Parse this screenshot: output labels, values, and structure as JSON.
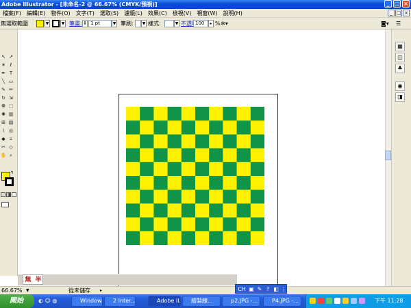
{
  "window": {
    "title": "Adobe Illustrator - [未命名-2 @ 66.67% (CMYK/預視)]",
    "buttons": [
      "_",
      "□",
      "×"
    ]
  },
  "menubar": {
    "items": [
      "檔案(F)",
      "編輯(E)",
      "物件(O)",
      "文字(T)",
      "選取(S)",
      "濾鏡(L)",
      "效果(C)",
      "檢視(V)",
      "視窗(W)",
      "說明(H)"
    ],
    "doc_buttons": [
      "_",
      "□",
      "×"
    ]
  },
  "controlbar": {
    "selection_label": "無選取範圍",
    "stroke_label": "筆畫:",
    "stroke_weight": "1 pt",
    "brush_label": "筆刷:",
    "style_label": "樣式:",
    "opacity_label": "不透明度:",
    "opacity_value": "100",
    "opacity_unit": "%"
  },
  "colors": {
    "yellow": "#FFF200",
    "green": "#109447",
    "fill_swatch": "#FFF200",
    "stroke_swatch": "#000000"
  },
  "checkerboard": {
    "rows": 10,
    "cols": 10
  },
  "statusbar": {
    "zoom": "66.67%",
    "status_text": "從未儲存",
    "ime_glyphs": [
      "無",
      "半"
    ]
  },
  "langbar": {
    "label": "CH"
  },
  "taskbar": {
    "start_label": "開始",
    "buttons": [
      "Window...",
      "2 Inter...",
      "Adobe Il...",
      "繪製線...",
      "p2.JPG -...",
      "P4.JPG -..."
    ],
    "clock": "下午 11:28"
  }
}
